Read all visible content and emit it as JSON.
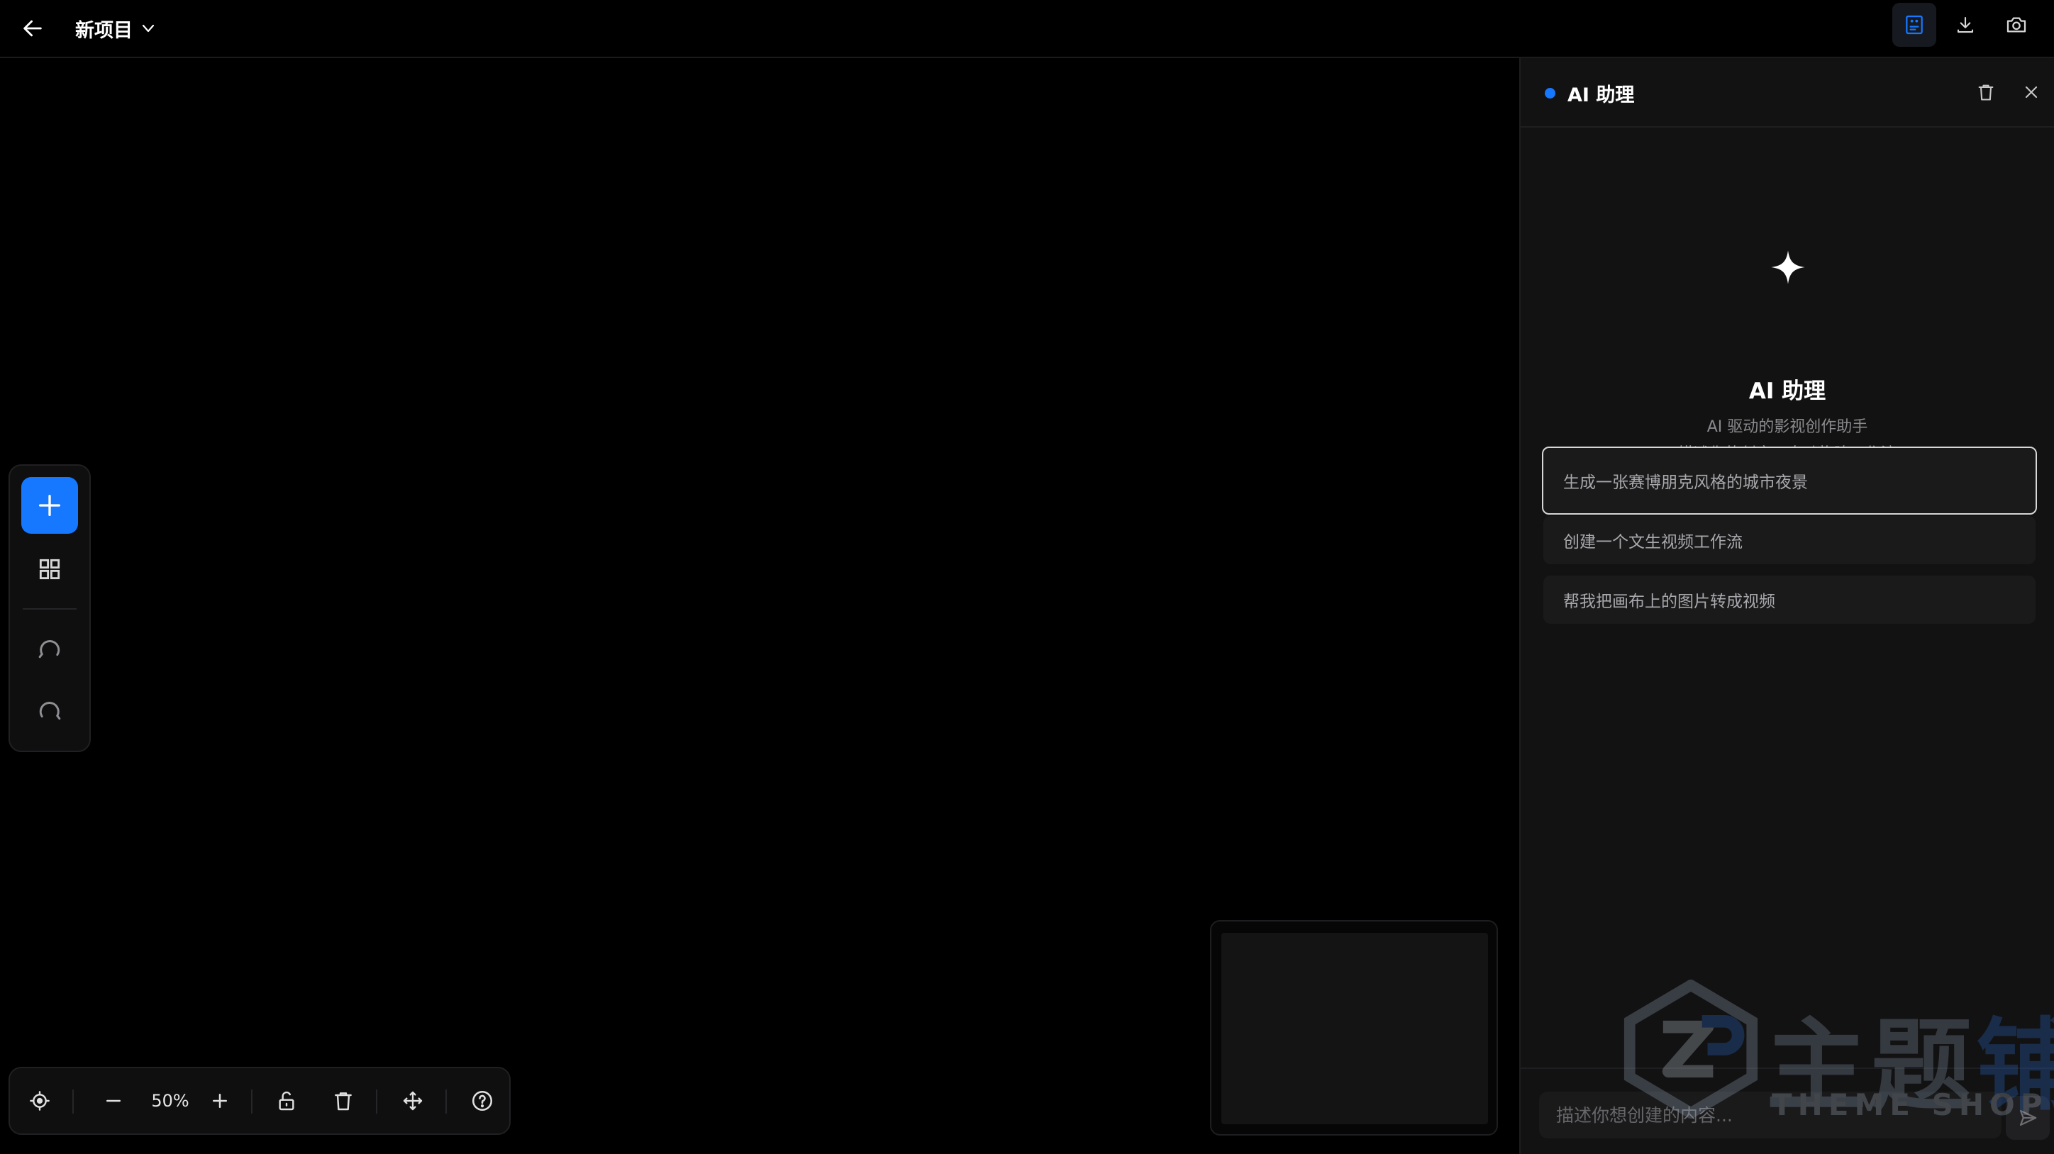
{
  "header": {
    "project_title": "新项目",
    "icons": {
      "back": "arrow-left-icon",
      "title_dropdown": "chevron-down-icon",
      "ai_toggle": "ai-assistant-icon",
      "download": "download-icon",
      "screenshot": "camera-icon"
    },
    "ai_toggle_active": true
  },
  "left_toolbar": {
    "items": [
      "plus-icon",
      "grid-icon",
      "undo-icon",
      "redo-icon"
    ],
    "accent": "#1677ff"
  },
  "bottom_toolbar": {
    "zoom": "50%",
    "items": [
      "locate-icon",
      "zoom-out-icon",
      "zoom-in-icon",
      "unlock-icon",
      "trash-icon",
      "move-icon",
      "help-icon"
    ]
  },
  "ai_panel": {
    "header_title": "AI 助理",
    "status_color": "#1677ff",
    "title": "AI 助理",
    "subtitle_line1": "AI 驱动的影视创作助手",
    "subtitle_line2": "描述你的创意，自动构建工作流",
    "suggestions": [
      "生成一张赛博朋克风格的城市夜景",
      "创建一个文生视频工作流",
      "帮我把画布上的图片转成视频"
    ],
    "input_placeholder": "描述你想创建的内容...",
    "icons": {
      "clear": "trash-icon",
      "close": "close-icon",
      "logo": "sparkle-icon",
      "send": "send-icon"
    }
  },
  "watermark": {
    "brand_main": "主题",
    "brand_accent": "铺",
    "brand_sub": "THEME SHOP"
  }
}
